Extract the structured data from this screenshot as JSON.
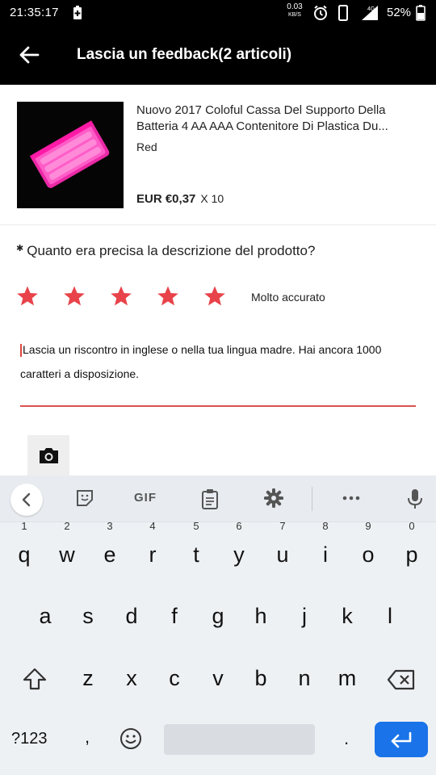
{
  "status_bar": {
    "time": "21:35:17",
    "net_speed": "0.03",
    "net_unit": "KB/S",
    "network_type": "4G",
    "battery": "52%"
  },
  "app_bar": {
    "title": "Lascia un feedback(2 articoli)"
  },
  "product": {
    "title": "Nuovo 2017 Coloful Cassa Del Supporto Della Batteria 4 AA AAA Contenitore Di Plastica Du...",
    "variant": "Red",
    "price": "EUR €0,37",
    "quantity": "X 10"
  },
  "question": {
    "required_mark": "✱",
    "text": "Quanto era precisa la descrizione del prodotto?",
    "rating": 5,
    "rating_max": 5,
    "rating_label": "Molto accurato"
  },
  "feedback": {
    "placeholder": "Lascia un riscontro in inglese o nella tua lingua madre. Hai ancora 1000 caratteri a disposizione."
  },
  "keyboard": {
    "toolbar_gif": "GIF",
    "row1": [
      {
        "letter": "q",
        "hint": "1"
      },
      {
        "letter": "w",
        "hint": "2"
      },
      {
        "letter": "e",
        "hint": "3"
      },
      {
        "letter": "r",
        "hint": "4"
      },
      {
        "letter": "t",
        "hint": "5"
      },
      {
        "letter": "y",
        "hint": "6"
      },
      {
        "letter": "u",
        "hint": "7"
      },
      {
        "letter": "i",
        "hint": "8"
      },
      {
        "letter": "o",
        "hint": "9"
      },
      {
        "letter": "p",
        "hint": "0"
      }
    ],
    "row2": [
      "a",
      "s",
      "d",
      "f",
      "g",
      "h",
      "j",
      "k",
      "l"
    ],
    "row3": [
      "z",
      "x",
      "c",
      "v",
      "b",
      "n",
      "m"
    ],
    "symbols_label": "?123",
    "comma": ",",
    "period": "."
  },
  "colors": {
    "accent_red": "#e8434a",
    "enter_blue": "#1a73e8",
    "product_pink": "#ff2db4"
  },
  "icons": [
    "back-arrow-icon",
    "camera-icon",
    "gear-icon",
    "mic-icon",
    "emoji-icon",
    "clipboard-icon",
    "sticker-icon",
    "backspace-icon",
    "shift-icon",
    "enter-icon"
  ]
}
